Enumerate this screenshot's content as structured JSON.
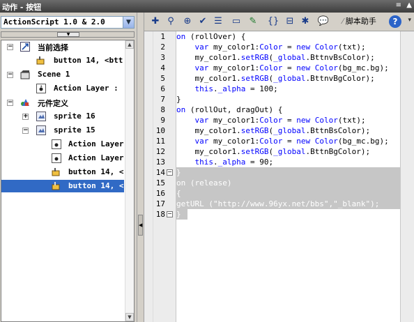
{
  "window": {
    "title": "动作 - 按钮",
    "menu_icon": "≡",
    "scroll_icon": "▲"
  },
  "left": {
    "script_select": {
      "value": "ActionScript 1.0 & 2.0"
    },
    "tree": [
      {
        "label": "当前选择",
        "icon": "selection-icon",
        "expanded": true
      },
      {
        "label": "button 14, <btt",
        "icon": "button-icon"
      },
      {
        "label": "Scene 1",
        "icon": "scene-icon",
        "expanded": true
      },
      {
        "label": "Action Layer :",
        "icon": "action-layer-icon"
      },
      {
        "label": "元件定义",
        "icon": "symbol-icon",
        "expanded": true
      },
      {
        "label": "sprite 16",
        "icon": "sprite-icon",
        "expanded": false
      },
      {
        "label": "sprite 15",
        "icon": "sprite-icon",
        "expanded": true
      },
      {
        "label": "Action Layer",
        "icon": "action-layer-icon"
      },
      {
        "label": "Action Layer",
        "icon": "action-layer-icon"
      },
      {
        "label": "button 14, <",
        "icon": "button-icon"
      },
      {
        "label": "button 14, <",
        "icon": "button-icon",
        "selected": true
      }
    ]
  },
  "toolbar": {
    "buttons": [
      {
        "name": "add-script-icon",
        "glyph": "✚"
      },
      {
        "name": "find-icon",
        "glyph": "⚲"
      },
      {
        "name": "target-icon",
        "glyph": "⊕"
      },
      {
        "name": "check-syntax-icon",
        "glyph": "✔"
      },
      {
        "name": "auto-format-icon",
        "glyph": "☰"
      },
      {
        "name": "code-hint-icon",
        "glyph": "▭"
      },
      {
        "name": "debug-options-icon",
        "glyph": "✎"
      },
      {
        "name": "collapse-braces-icon",
        "glyph": "{}"
      },
      {
        "name": "collapse-selection-icon",
        "glyph": "⊟"
      },
      {
        "name": "expand-all-icon",
        "glyph": "✱"
      },
      {
        "name": "comment-icon",
        "glyph": "💬"
      }
    ],
    "script_assist_label": "脚本助手",
    "help_label": "?",
    "menu_label": "▾"
  },
  "code": {
    "line_numbers": [
      "1",
      "2",
      "3",
      "4",
      "5",
      "6",
      "7",
      "8",
      "9",
      "10",
      "11",
      "12",
      "13",
      "14",
      "15",
      "16",
      "17",
      "18"
    ],
    "lines": [
      "on (rollOver) {",
      "    var my_color1:Color = new Color(txt);",
      "    my_color1.setRGB(_global.BttnvBsColor);",
      "    var my_color1:Color = new Color(bg_mc.bg);",
      "    my_color1.setRGB(_global.BttnvBgColor);",
      "    this._alpha = 100;",
      "}",
      "on (rollOut, dragOut) {",
      "    var my_color1:Color = new Color(txt);",
      "    my_color1.setRGB(_global.BttnBsColor);",
      "    var my_color1:Color = new Color(bg_mc.bg);",
      "    my_color1.setRGB(_global.BttnBgColor);",
      "    this._alpha = 90;",
      "}",
      "on (release)",
      "{",
      "getURL (\"http://www.96yx.net/bbs\",\"_blank\");",
      "}"
    ],
    "highlighted_lines": [
      14,
      15,
      16,
      17,
      18
    ],
    "fold_markers": [
      "14",
      "18"
    ]
  },
  "colors": {
    "keyword": "#0000ff",
    "selection": "#316ac5",
    "highlight": "#c6c6c6"
  }
}
